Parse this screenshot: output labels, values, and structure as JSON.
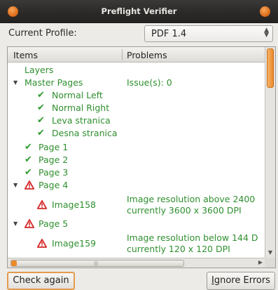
{
  "window": {
    "title": "Preflight Verifier"
  },
  "profile": {
    "label": "Current Profile:",
    "value": "PDF 1.4"
  },
  "tree": {
    "columns": [
      "Items",
      "Problems"
    ],
    "rows": [
      {
        "label": "Layers",
        "problem": ""
      },
      {
        "label": "Master Pages",
        "problem": "Issue(s): 0"
      },
      {
        "label": "Normal Left",
        "problem": ""
      },
      {
        "label": "Normal Right",
        "problem": ""
      },
      {
        "label": "Leva stranica",
        "problem": ""
      },
      {
        "label": "Desna stranica",
        "problem": ""
      },
      {
        "label": "Page 1",
        "problem": ""
      },
      {
        "label": "Page 2",
        "problem": ""
      },
      {
        "label": "Page 3",
        "problem": ""
      },
      {
        "label": "Page 4",
        "problem": ""
      },
      {
        "label": "Image158",
        "problem_line1": "Image resolution above 2400",
        "problem_line2": "currently 3600 x 3600 DPI"
      },
      {
        "label": "Page 5",
        "problem": ""
      },
      {
        "label": "Image159",
        "problem_line1": "Image resolution below 144 D",
        "problem_line2": "currently 120 x 120 DPI"
      }
    ]
  },
  "buttons": {
    "check_again": "Check again",
    "ignore_errors_prefix": "I",
    "ignore_errors_rest": "gnore Errors"
  },
  "colors": {
    "accent": "#eb8a2b",
    "ok_text": "#2f8f2f",
    "error_icon": "#d42a2a"
  }
}
